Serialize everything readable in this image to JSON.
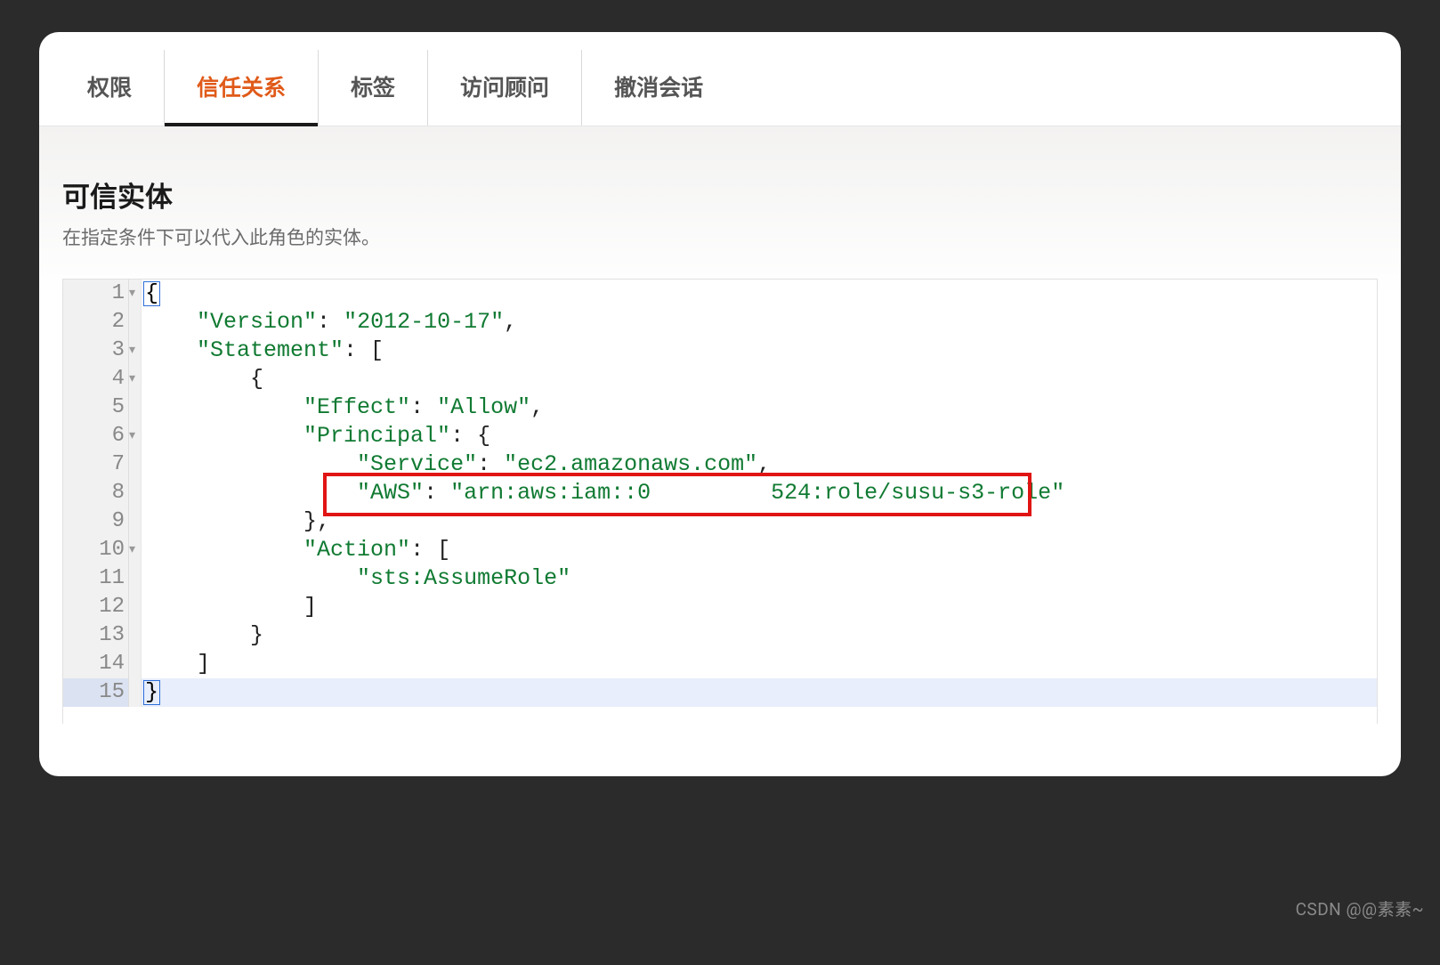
{
  "tabs": [
    {
      "label": "权限",
      "active": false
    },
    {
      "label": "信任关系",
      "active": true
    },
    {
      "label": "标签",
      "active": false
    },
    {
      "label": "访问顾问",
      "active": false
    },
    {
      "label": "撤消会话",
      "active": false
    }
  ],
  "section": {
    "title": "可信实体",
    "subtitle": "在指定条件下可以代入此角色的实体。"
  },
  "code": {
    "lines": [
      {
        "num": "1",
        "fold": "▾",
        "indent": 0,
        "tokens": [
          {
            "t": "cursor",
            "v": "{"
          }
        ]
      },
      {
        "num": "2",
        "fold": "",
        "indent": 1,
        "tokens": [
          {
            "t": "key",
            "v": "\"Version\""
          },
          {
            "t": "punct",
            "v": ": "
          },
          {
            "t": "str",
            "v": "\"2012-10-17\""
          },
          {
            "t": "punct",
            "v": ","
          }
        ]
      },
      {
        "num": "3",
        "fold": "▾",
        "indent": 1,
        "tokens": [
          {
            "t": "key",
            "v": "\"Statement\""
          },
          {
            "t": "punct",
            "v": ": ["
          }
        ]
      },
      {
        "num": "4",
        "fold": "▾",
        "indent": 2,
        "tokens": [
          {
            "t": "punct",
            "v": "{"
          }
        ]
      },
      {
        "num": "5",
        "fold": "",
        "indent": 3,
        "tokens": [
          {
            "t": "key",
            "v": "\"Effect\""
          },
          {
            "t": "punct",
            "v": ": "
          },
          {
            "t": "str",
            "v": "\"Allow\""
          },
          {
            "t": "punct",
            "v": ","
          }
        ]
      },
      {
        "num": "6",
        "fold": "▾",
        "indent": 3,
        "tokens": [
          {
            "t": "key",
            "v": "\"Principal\""
          },
          {
            "t": "punct",
            "v": ": {"
          }
        ]
      },
      {
        "num": "7",
        "fold": "",
        "indent": 4,
        "tokens": [
          {
            "t": "key",
            "v": "\"Service\""
          },
          {
            "t": "punct",
            "v": ": "
          },
          {
            "t": "str",
            "v": "\"ec2.amazonaws.com\""
          },
          {
            "t": "punct",
            "v": ","
          }
        ]
      },
      {
        "num": "8",
        "fold": "",
        "indent": 4,
        "highlight": true,
        "tokens": [
          {
            "t": "key",
            "v": "\"AWS\""
          },
          {
            "t": "punct",
            "v": ": "
          },
          {
            "t": "str",
            "v": "\"arn:aws:iam::0         524:role/susu-s3-role\""
          }
        ]
      },
      {
        "num": "9",
        "fold": "",
        "indent": 3,
        "tokens": [
          {
            "t": "punct",
            "v": "},"
          }
        ]
      },
      {
        "num": "10",
        "fold": "▾",
        "indent": 3,
        "tokens": [
          {
            "t": "key",
            "v": "\"Action\""
          },
          {
            "t": "punct",
            "v": ": ["
          }
        ]
      },
      {
        "num": "11",
        "fold": "",
        "indent": 4,
        "tokens": [
          {
            "t": "str",
            "v": "\"sts:AssumeRole\""
          }
        ]
      },
      {
        "num": "12",
        "fold": "",
        "indent": 3,
        "tokens": [
          {
            "t": "punct",
            "v": "]"
          }
        ]
      },
      {
        "num": "13",
        "fold": "",
        "indent": 2,
        "tokens": [
          {
            "t": "punct",
            "v": "}"
          }
        ]
      },
      {
        "num": "14",
        "fold": "",
        "indent": 1,
        "tokens": [
          {
            "t": "punct",
            "v": "]"
          }
        ]
      },
      {
        "num": "15",
        "fold": "",
        "indent": 0,
        "active": true,
        "tokens": [
          {
            "t": "cursor",
            "v": "}"
          }
        ]
      }
    ]
  },
  "watermark": "CSDN @@素素~"
}
